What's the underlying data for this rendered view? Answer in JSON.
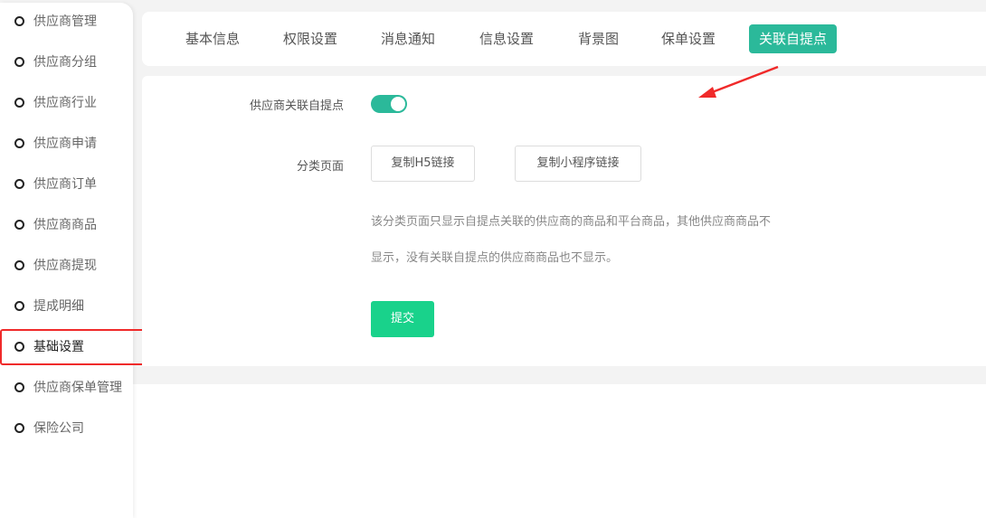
{
  "sidebar": {
    "items": [
      {
        "label": "供应商管理"
      },
      {
        "label": "供应商分组"
      },
      {
        "label": "供应商行业"
      },
      {
        "label": "供应商申请"
      },
      {
        "label": "供应商订单"
      },
      {
        "label": "供应商商品"
      },
      {
        "label": "供应商提现"
      },
      {
        "label": "提成明细"
      },
      {
        "label": "基础设置"
      },
      {
        "label": "供应商保单管理"
      },
      {
        "label": "保险公司"
      }
    ],
    "active_index": 8
  },
  "tabs": [
    {
      "label": "基本信息"
    },
    {
      "label": "权限设置"
    },
    {
      "label": "消息通知"
    },
    {
      "label": "信息设置"
    },
    {
      "label": "背景图"
    },
    {
      "label": "保单设置"
    },
    {
      "label": "关联自提点"
    }
  ],
  "form": {
    "toggle_label": "供应商关联自提点",
    "toggle_on": true,
    "category_label": "分类页面",
    "copy_h5": "复制H5链接",
    "copy_mini": "复制小程序链接",
    "desc_line1": "该分类页面只显示自提点关联的供应商的商品和平台商品，其他供应商商品不",
    "desc_line2": "显示，没有关联自提点的供应商商品也不显示。",
    "submit": "提交"
  },
  "colors": {
    "accent": "#2bb99a",
    "submit": "#19d28b",
    "annotation": "#f02a2a"
  }
}
